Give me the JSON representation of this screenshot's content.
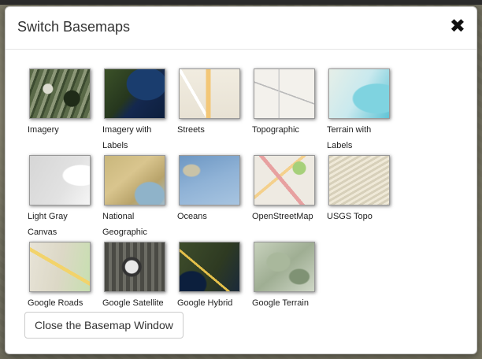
{
  "modal": {
    "title": "Switch Basemaps",
    "close_glyph": "✖",
    "close_button_label": "Close the Basemap Window"
  },
  "basemaps": [
    {
      "label": "Imagery",
      "thumb": "t-imagery"
    },
    {
      "label": "Imagery with Labels",
      "thumb": "t-imagery-labels"
    },
    {
      "label": "Streets",
      "thumb": "t-streets"
    },
    {
      "label": "Topographic",
      "thumb": "t-topographic"
    },
    {
      "label": "Terrain with Labels",
      "thumb": "t-terrain"
    },
    {
      "label": "Light Gray Canvas",
      "thumb": "t-lightgray"
    },
    {
      "label": "National Geographic",
      "thumb": "t-natgeo"
    },
    {
      "label": "Oceans",
      "thumb": "t-oceans"
    },
    {
      "label": "OpenStreetMap",
      "thumb": "t-osm"
    },
    {
      "label": "USGS Topo",
      "thumb": "t-usgs"
    },
    {
      "label": "Google Roads",
      "thumb": "t-groads"
    },
    {
      "label": "Google Satellite",
      "thumb": "t-gsat"
    },
    {
      "label": "Google Hybrid",
      "thumb": "t-ghybrid"
    },
    {
      "label": "Google Terrain",
      "thumb": "t-gterrain"
    }
  ]
}
